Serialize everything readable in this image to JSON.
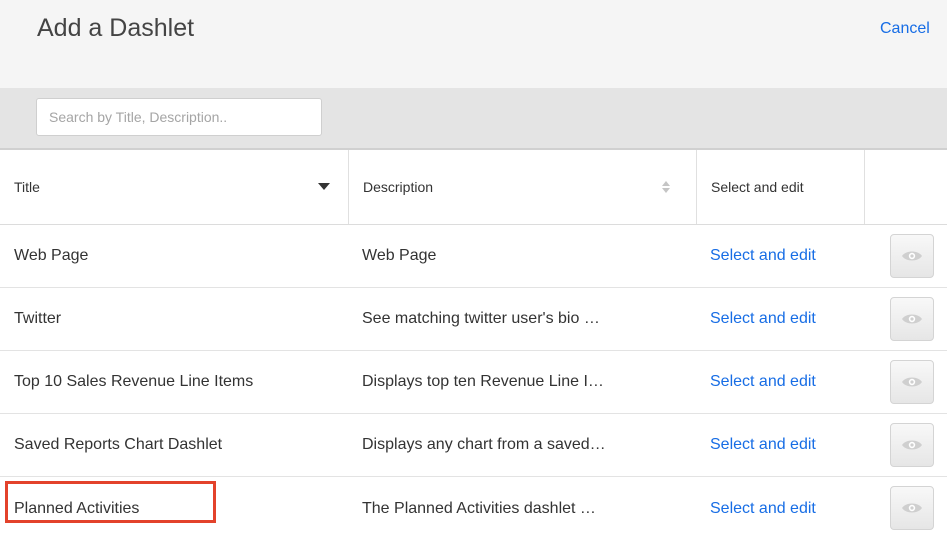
{
  "header": {
    "title": "Add a Dashlet",
    "cancel_label": "Cancel"
  },
  "search": {
    "placeholder": "Search by Title, Description.."
  },
  "table": {
    "columns": {
      "title": "Title",
      "description": "Description",
      "select": "Select and edit"
    },
    "rows": [
      {
        "title": "Web Page",
        "description": "Web Page",
        "action": "Select and edit"
      },
      {
        "title": "Twitter",
        "description": "See matching twitter user's bio …",
        "action": "Select and edit"
      },
      {
        "title": "Top 10 Sales Revenue Line Items",
        "description": "Displays top ten Revenue Line I…",
        "action": "Select and edit"
      },
      {
        "title": "Saved Reports Chart Dashlet",
        "description": "Displays any chart from a saved…",
        "action": "Select and edit"
      },
      {
        "title": "Planned Activities",
        "description": "The Planned Activities dashlet …",
        "action": "Select and edit"
      }
    ],
    "preview_icon": "eye-icon",
    "sort": {
      "column": "title",
      "direction": "descending"
    }
  },
  "colors": {
    "link": "#176de5",
    "highlight": "#e3422b",
    "header_bg": "#f5f5f5",
    "search_bar_bg": "#e4e4e4"
  }
}
